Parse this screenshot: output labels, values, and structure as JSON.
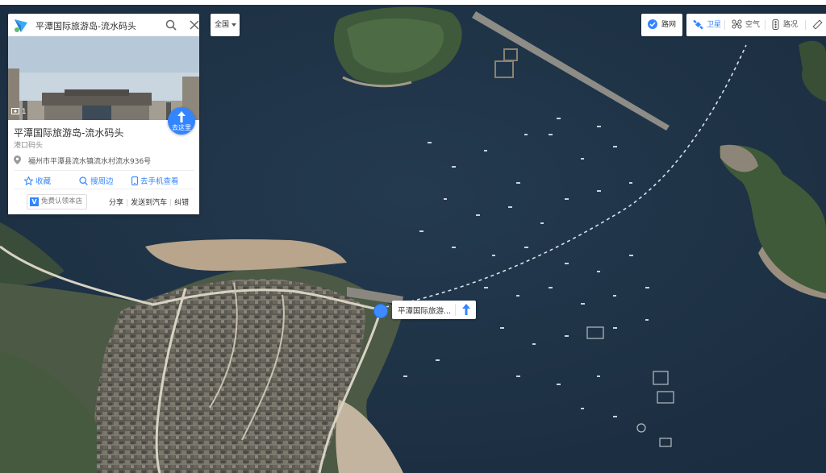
{
  "search": {
    "query": "平潭国际旅游岛-流水码头",
    "icons": {
      "logo": "baidu-map-logo-icon",
      "search": "search-icon",
      "close": "close-icon"
    }
  },
  "card": {
    "photo_count": "1",
    "go_label": "去这里",
    "place_name": "平潭国际旅游岛-流水码头",
    "place_type": "港口码头",
    "address": "福州市平潭县流水镇流水村流水936号",
    "actions": [
      {
        "label": "收藏",
        "icon": "star-icon"
      },
      {
        "label": "搜周边",
        "icon": "search-nearby-icon"
      },
      {
        "label": "去手机查看",
        "icon": "phone-icon"
      }
    ],
    "claim_badge": "V",
    "claim_label": "免费认领本店",
    "links": [
      "分享",
      "发送到汽车",
      "纠错"
    ]
  },
  "scope": {
    "label": "全国"
  },
  "toolbar": {
    "roadnet": "路网",
    "satellite": "卫星",
    "air": "空气",
    "traffic": "路况"
  },
  "marker": {
    "label": "平潭国际旅游..."
  },
  "colors": {
    "accent": "#3385ff",
    "sea": "#213548",
    "marker": "#3d8bff"
  }
}
